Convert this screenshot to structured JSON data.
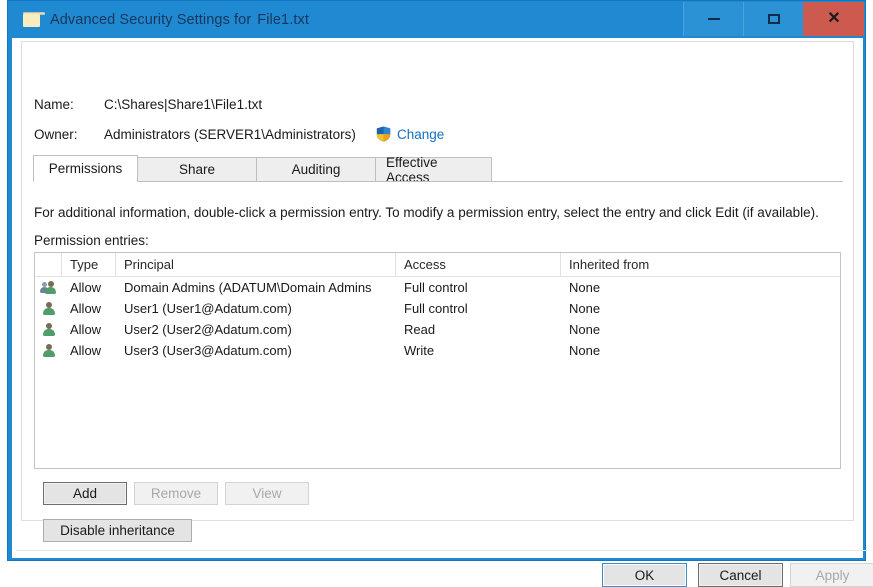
{
  "titlebar": {
    "icon": "folder-icon",
    "title_prefix": "Advanced Security Settings for",
    "file_name": "File1.txt",
    "minimize_label": "–",
    "maximize_label": "□",
    "close_label": "✕",
    "background_color": "#1f8ad2",
    "close_color": "#cc5a4e"
  },
  "header": {
    "name_label": "Name:",
    "name_value": "C:\\Shares|Share1\\File1.txt",
    "owner_label": "Owner:",
    "owner_value": "Administrators (SERVER1\\Administrators)",
    "change_link": "Change",
    "change_icon": "shield-icon",
    "link_color": "#1570c0"
  },
  "tabs": [
    {
      "label": "Permissions",
      "active": true
    },
    {
      "label": "Share",
      "active": false
    },
    {
      "label": "Auditing",
      "active": false
    },
    {
      "label": "Effective Access",
      "active": false
    }
  ],
  "main": {
    "instructions": "For additional information, double-click a permission entry. To modify a permission entry, select the entry and click Edit (if available).",
    "entries_label": "Permission entries:"
  },
  "table": {
    "columns": [
      "",
      "Type",
      "Principal",
      "Access",
      "Inherited from"
    ],
    "rows": [
      {
        "icon": "group-icon",
        "type": "Allow",
        "principal": "Domain Admins (ADATUM\\Domain Admins",
        "access": "Full control",
        "inherited_from": "None"
      },
      {
        "icon": "user-icon",
        "type": "Allow",
        "principal": "User1 (User1@Adatum.com)",
        "access": "Full control",
        "inherited_from": "None"
      },
      {
        "icon": "user-icon",
        "type": "Allow",
        "principal": "User2 (User2@Adatum.com)",
        "access": "Read",
        "inherited_from": "None"
      },
      {
        "icon": "user-icon",
        "type": "Allow",
        "principal": "User3 (User3@Adatum.com)",
        "access": "Write",
        "inherited_from": "None"
      }
    ]
  },
  "actions": {
    "add": "Add",
    "remove": "Remove",
    "view": "View",
    "disable_inheritance": "Disable inheritance"
  },
  "footer": {
    "ok": "OK",
    "cancel": "Cancel",
    "apply": "Apply"
  }
}
